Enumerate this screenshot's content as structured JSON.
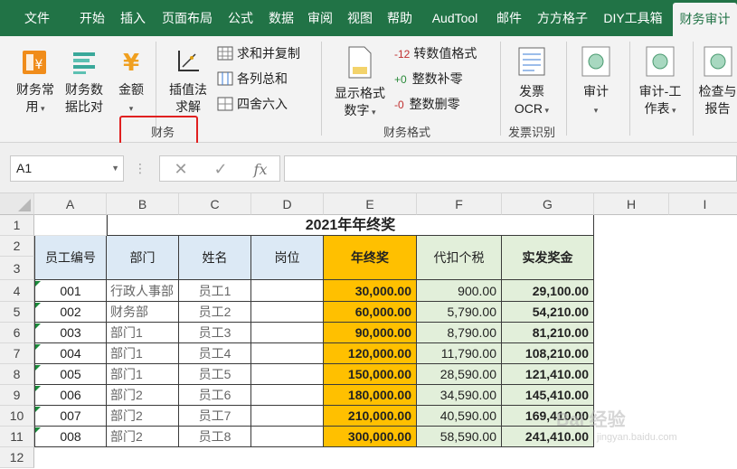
{
  "tabs": [
    "文件",
    "开始",
    "插入",
    "页面布局",
    "公式",
    "数据",
    "审阅",
    "视图",
    "帮助",
    "AudTool",
    "邮件",
    "方方格子",
    "DIY工具箱",
    "财务审计"
  ],
  "active_tab": "财务审计",
  "ribbon": {
    "finance_common": "财务常用",
    "finance_compare": "财务数据比对",
    "amount": "金额",
    "interp": "插值法求解",
    "sum_copy": "求和并复制",
    "col_sum": "各列总和",
    "round": "四舍六入",
    "group_finance": "财务",
    "show_format": "显示格式数字",
    "to_num": "转数值格式",
    "pad_zero": "整数补零",
    "del_zero": "整数删零",
    "to_num_prefix": "12",
    "pad_prefix": "+0",
    "del_prefix": "-0",
    "group_format": "财务格式",
    "invoice": "发票OCR",
    "group_invoice": "发票识别",
    "audit": "审计",
    "audit_work": "审计-工作表",
    "check_report": "检查与报告"
  },
  "formula_bar": {
    "namebox": "A1",
    "fx": "fx",
    "formula": ""
  },
  "columns": [
    "A",
    "B",
    "C",
    "D",
    "E",
    "F",
    "G",
    "H",
    "I"
  ],
  "rows": [
    "1",
    "2",
    "3",
    "4",
    "5",
    "6",
    "7",
    "8",
    "9",
    "10",
    "11",
    "12"
  ],
  "sheet": {
    "title": "2021年年终奖",
    "headers": [
      "员工编号",
      "部门",
      "姓名",
      "岗位",
      "年终奖",
      "代扣个税",
      "实发奖金"
    ],
    "data": [
      [
        "001",
        "行政人事部",
        "员工1",
        "",
        "30,000.00",
        "900.00",
        "29,100.00"
      ],
      [
        "002",
        "财务部",
        "员工2",
        "",
        "60,000.00",
        "5,790.00",
        "54,210.00"
      ],
      [
        "003",
        "部门1",
        "员工3",
        "",
        "90,000.00",
        "8,790.00",
        "81,210.00"
      ],
      [
        "004",
        "部门1",
        "员工4",
        "",
        "120,000.00",
        "11,790.00",
        "108,210.00"
      ],
      [
        "005",
        "部门1",
        "员工5",
        "",
        "150,000.00",
        "28,590.00",
        "121,410.00"
      ],
      [
        "006",
        "部门2",
        "员工6",
        "",
        "180,000.00",
        "34,590.00",
        "145,410.00"
      ],
      [
        "007",
        "部门2",
        "员工7",
        "",
        "210,000.00",
        "40,590.00",
        "169,410.00"
      ],
      [
        "008",
        "部门2",
        "员工8",
        "",
        "300,000.00",
        "58,590.00",
        "241,410.00"
      ]
    ]
  },
  "watermark": "Bai 经验",
  "watermark_sub": "jingyan.baidu.com",
  "colors": {
    "tab_green": "#217346",
    "header_blue": "#dce9f5",
    "bonus_orange": "#ffc000",
    "tax_green": "#e2efda",
    "highlight_red": "#e02020"
  }
}
